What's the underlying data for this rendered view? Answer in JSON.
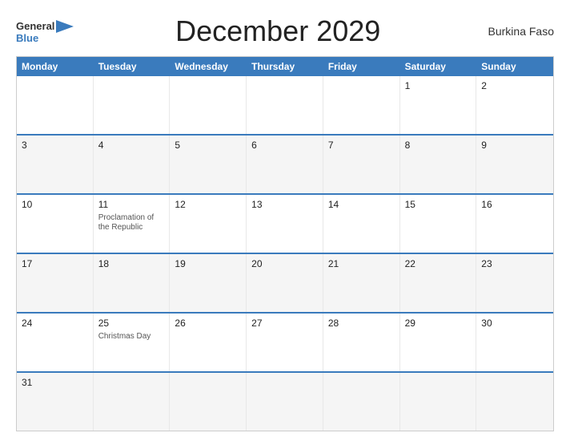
{
  "header": {
    "logo_general": "General",
    "logo_blue": "Blue",
    "title": "December 2029",
    "country": "Burkina Faso"
  },
  "calendar": {
    "days_of_week": [
      "Monday",
      "Tuesday",
      "Wednesday",
      "Thursday",
      "Friday",
      "Saturday",
      "Sunday"
    ],
    "rows": [
      [
        {
          "num": "",
          "holiday": ""
        },
        {
          "num": "",
          "holiday": ""
        },
        {
          "num": "",
          "holiday": ""
        },
        {
          "num": "",
          "holiday": ""
        },
        {
          "num": "",
          "holiday": ""
        },
        {
          "num": "1",
          "holiday": ""
        },
        {
          "num": "2",
          "holiday": ""
        }
      ],
      [
        {
          "num": "3",
          "holiday": ""
        },
        {
          "num": "4",
          "holiday": ""
        },
        {
          "num": "5",
          "holiday": ""
        },
        {
          "num": "6",
          "holiday": ""
        },
        {
          "num": "7",
          "holiday": ""
        },
        {
          "num": "8",
          "holiday": ""
        },
        {
          "num": "9",
          "holiday": ""
        }
      ],
      [
        {
          "num": "10",
          "holiday": ""
        },
        {
          "num": "11",
          "holiday": "Proclamation of the Republic"
        },
        {
          "num": "12",
          "holiday": ""
        },
        {
          "num": "13",
          "holiday": ""
        },
        {
          "num": "14",
          "holiday": ""
        },
        {
          "num": "15",
          "holiday": ""
        },
        {
          "num": "16",
          "holiday": ""
        }
      ],
      [
        {
          "num": "17",
          "holiday": ""
        },
        {
          "num": "18",
          "holiday": ""
        },
        {
          "num": "19",
          "holiday": ""
        },
        {
          "num": "20",
          "holiday": ""
        },
        {
          "num": "21",
          "holiday": ""
        },
        {
          "num": "22",
          "holiday": ""
        },
        {
          "num": "23",
          "holiday": ""
        }
      ],
      [
        {
          "num": "24",
          "holiday": ""
        },
        {
          "num": "25",
          "holiday": "Christmas Day"
        },
        {
          "num": "26",
          "holiday": ""
        },
        {
          "num": "27",
          "holiday": ""
        },
        {
          "num": "28",
          "holiday": ""
        },
        {
          "num": "29",
          "holiday": ""
        },
        {
          "num": "30",
          "holiday": ""
        }
      ],
      [
        {
          "num": "31",
          "holiday": ""
        },
        {
          "num": "",
          "holiday": ""
        },
        {
          "num": "",
          "holiday": ""
        },
        {
          "num": "",
          "holiday": ""
        },
        {
          "num": "",
          "holiday": ""
        },
        {
          "num": "",
          "holiday": ""
        },
        {
          "num": "",
          "holiday": ""
        }
      ]
    ]
  }
}
